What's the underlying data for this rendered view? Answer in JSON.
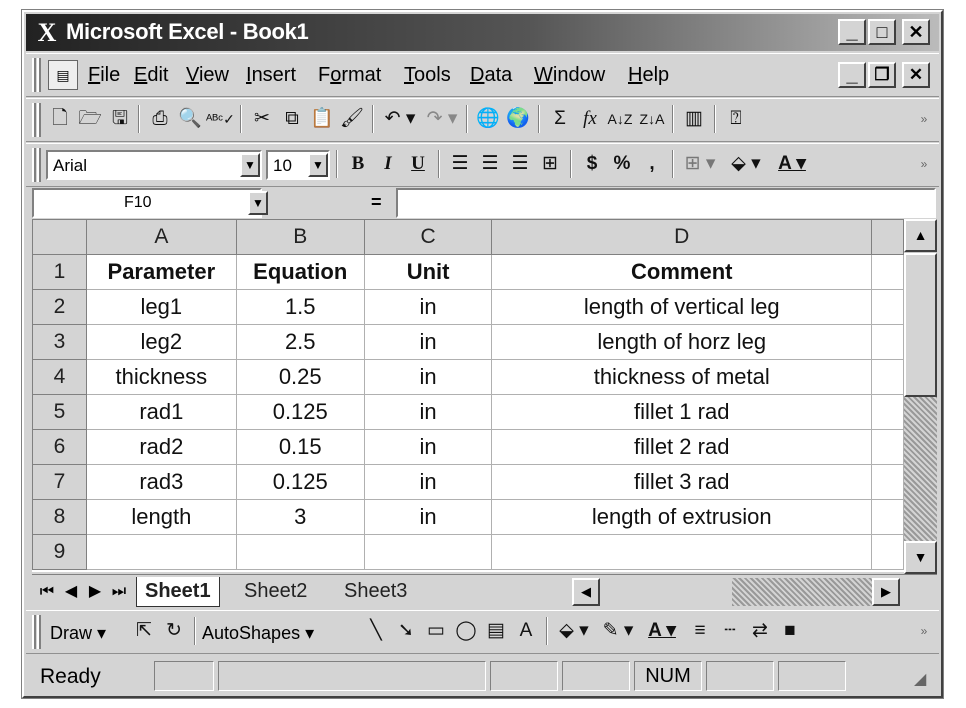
{
  "window": {
    "title": "Microsoft Excel - Book1",
    "logo": "X"
  },
  "controls": {
    "minimize": "_",
    "maximize": "□",
    "close": "✕",
    "doc_minimize": "_",
    "doc_restore": "❐",
    "doc_close": "✕"
  },
  "menu": [
    "File",
    "Edit",
    "View",
    "Insert",
    "Format",
    "Tools",
    "Data",
    "Window",
    "Help"
  ],
  "menu_access": [
    "F",
    "E",
    "V",
    "I",
    "o",
    "T",
    "D",
    "W",
    "H"
  ],
  "standard_toolbar": [
    "new-icon",
    "open-icon",
    "save-icon",
    "print-icon",
    "print-preview-icon",
    "spelling-icon",
    "cut-icon",
    "copy-icon",
    "paste-icon",
    "format-painter-icon",
    "undo-icon",
    "redo-icon",
    "insert-hyperlink-icon",
    "web-toolbar-icon",
    "autosum-icon",
    "paste-function-icon",
    "sort-ascending-icon",
    "sort-descending-icon",
    "chart-wizard-icon",
    "help-icon"
  ],
  "format": {
    "font": "Arial",
    "size": "10",
    "bold": "B",
    "italic": "I",
    "underline": "U",
    "currency": "$",
    "percent": "%",
    "comma": ","
  },
  "formula_bar": {
    "name_box": "F10",
    "equals": "=",
    "value": ""
  },
  "columns": [
    "A",
    "B",
    "C",
    "D"
  ],
  "rows": [
    {
      "num": "1",
      "cells": [
        "Parameter",
        "Equation",
        "Unit",
        "Comment"
      ],
      "bold": true
    },
    {
      "num": "2",
      "cells": [
        "leg1",
        "1.5",
        "in",
        "length of vertical leg"
      ]
    },
    {
      "num": "3",
      "cells": [
        "leg2",
        "2.5",
        "in",
        "length of horz leg"
      ]
    },
    {
      "num": "4",
      "cells": [
        "thickness",
        "0.25",
        "in",
        "thickness of metal"
      ]
    },
    {
      "num": "5",
      "cells": [
        "rad1",
        "0.125",
        "in",
        "fillet 1 rad"
      ]
    },
    {
      "num": "6",
      "cells": [
        "rad2",
        "0.15",
        "in",
        "fillet 2 rad"
      ]
    },
    {
      "num": "7",
      "cells": [
        "rad3",
        "0.125",
        "in",
        "fillet 3 rad"
      ]
    },
    {
      "num": "8",
      "cells": [
        "length",
        "3",
        "in",
        "length of extrusion"
      ]
    },
    {
      "num": "9",
      "cells": [
        "",
        "",
        "",
        ""
      ]
    }
  ],
  "sheets": [
    "Sheet1",
    "Sheet2",
    "Sheet3"
  ],
  "active_sheet": "Sheet1",
  "drawing": {
    "draw": "Draw",
    "autoshapes": "AutoShapes"
  },
  "status": {
    "ready": "Ready",
    "num": "NUM"
  }
}
